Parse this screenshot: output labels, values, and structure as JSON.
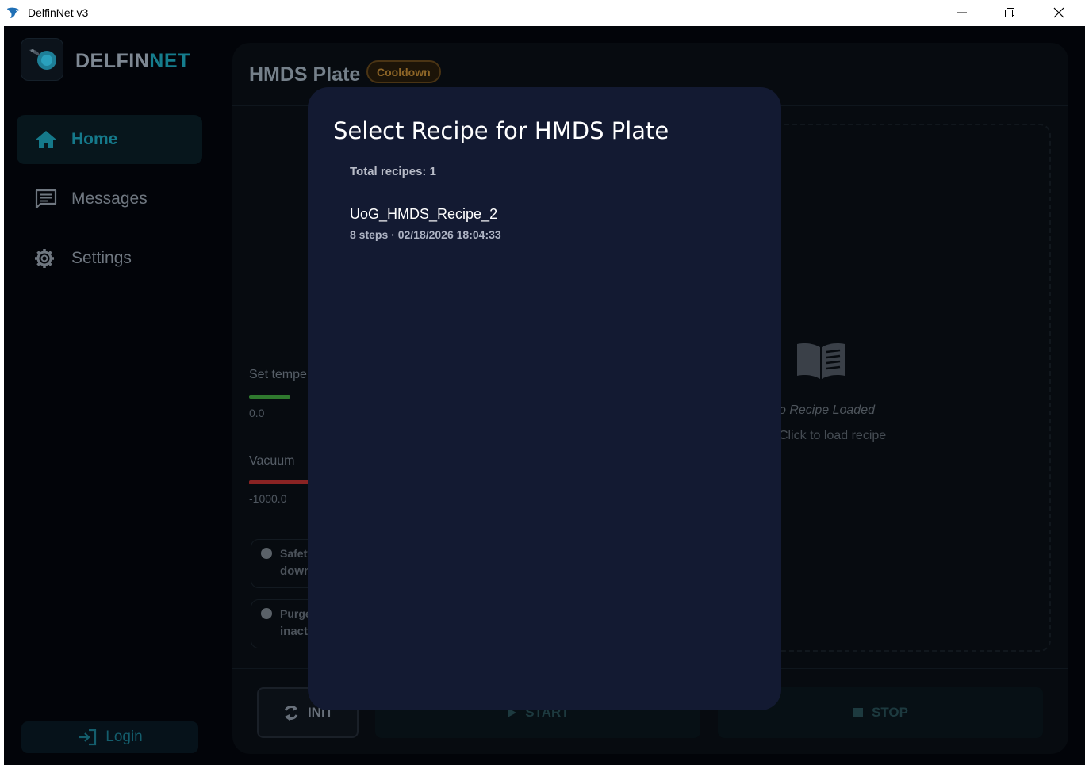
{
  "window": {
    "title": "DelfinNet v3"
  },
  "sidebar": {
    "brand_primary": "DELFIN",
    "brand_secondary": "NET",
    "items": [
      {
        "label": "Home",
        "icon": "home-icon",
        "active": true
      },
      {
        "label": "Messages",
        "icon": "message-icon",
        "active": false
      },
      {
        "label": "Settings",
        "icon": "gear-icon",
        "active": false
      }
    ],
    "login_label": "Login"
  },
  "main": {
    "title": "HMDS Plate",
    "status_badge": "Cooldown",
    "params": [
      {
        "label": "Set tempe",
        "value": "0.0",
        "bar_color": "#2f7a2e"
      },
      {
        "label": "Vacuum",
        "value": "-1000.0",
        "bar_color": "#8a2323"
      }
    ],
    "status_cards": [
      {
        "line1": "Safety",
        "line2": "down"
      },
      {
        "line1": "Purge",
        "line2": "inact"
      }
    ],
    "recipe_placeholder": {
      "title": "o Recipe Loaded",
      "hint": "Click to load recipe"
    },
    "controls": {
      "init_label": "INIT",
      "start_label": "START",
      "stop_label": "STOP"
    }
  },
  "modal": {
    "title": "Select Recipe for HMDS Plate",
    "total_label": "Total recipes: 1",
    "recipes": [
      {
        "name": "UoG_HMDS_Recipe_2",
        "meta": "8 steps · 02/18/2026 18:04:33"
      }
    ]
  },
  "colors": {
    "accent": "#157d8d",
    "modal_bg": "#131a32",
    "warning": "#8f6627"
  }
}
